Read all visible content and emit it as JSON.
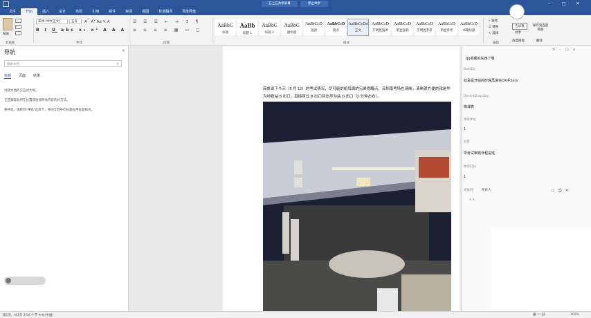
{
  "window": {
    "title_tabs": [
      "已上在共享屏幕",
      "停止共享"
    ]
  },
  "ribbon": {
    "tabs": [
      "文件",
      "开始",
      "插入",
      "设计",
      "布局",
      "引用",
      "邮件",
      "审阅",
      "视图",
      "有道翻译",
      "百度网盘"
    ],
    "active_tab": "开始",
    "paste_label": "粘贴",
    "font_name": "宋体 (中文正文)",
    "font_size": "五号",
    "group_labels": [
      "剪贴板",
      "字体",
      "段落",
      "样式",
      "编辑"
    ],
    "styles": [
      {
        "sample": "AaBbC",
        "name": "标题"
      },
      {
        "sample": "AaBb",
        "name": "标题 1"
      },
      {
        "sample": "AaBbC",
        "name": "标题 2"
      },
      {
        "sample": "AaBbC",
        "name": "副标题"
      },
      {
        "sample": "AaBbCcD",
        "name": "强调"
      },
      {
        "sample": "AaBbCcD",
        "name": "要点"
      },
      {
        "sample": "AaBbCcDd",
        "name": "正文"
      },
      {
        "sample": "AaBbCcD",
        "name": "不明显强调"
      },
      {
        "sample": "AaBbCcD",
        "name": "明显强调"
      },
      {
        "sample": "AaBbCcD",
        "name": "不明显参考"
      },
      {
        "sample": "AaBbCcD",
        "name": "明显参考"
      },
      {
        "sample": "AaBbCcD",
        "name": "书籍标题"
      }
    ],
    "edit_items": [
      "查找",
      "替换",
      "选择"
    ],
    "right_labels": [
      "告诉我",
      "共享",
      "保存到百度网盘",
      "百度网盘",
      "翻译"
    ]
  },
  "nav": {
    "title": "导航",
    "search_placeholder": "搜索文档",
    "tabs": [
      "标题",
      "页面",
      "结果"
    ],
    "lines": [
      "创建文档的交互式大纲。",
      "它是跟踪您所在位置或快速移动内容的好方法。",
      "要开始，请转到\"开始\"选项卡，并向文档中的标题应用标题样式。"
    ]
  },
  "document": {
    "paragraph": "简单说下今天（6 月 12）的考试情况，尽可能的给后面的兄弟提醒点，深圳南考场在清晰，清晰很方便的就是华为地铁站 B 出口，直接穿过 B 出口到达华为站 D 出口（2 分钟左右）。"
  },
  "right_pane": {
    "header": "qq收藏的东西了哦",
    "fields": [
      {
        "label": "BullsEq",
        "value": "就是是开始的时候再说在DX手Serv"
      },
      {
        "label": "DeviceSharpSky",
        "value": "微课表"
      },
      {
        "label": "你的评论",
        "value": "1"
      },
      {
        "label": "标签",
        "value": "华考试审题日程是啥"
      },
      {
        "label": "你的打分",
        "value": "1"
      }
    ],
    "bottom_label": "添加到：",
    "bottom_value": "所有人",
    "bottom_sub": "A A"
  },
  "statusbar": {
    "left": "第1页，共1页  2/56 个字  中文(中国)",
    "zoom": "100%"
  },
  "colors": {
    "accent": "#2b579a",
    "ribbon_bg": "#f3f3f3",
    "photo_bg": "#1e2433"
  }
}
